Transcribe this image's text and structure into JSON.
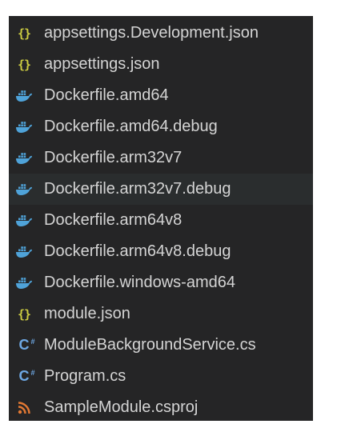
{
  "explorer": {
    "hovered_index": 5,
    "files": [
      {
        "label": "appsettings.Development.json",
        "icon": "json-icon"
      },
      {
        "label": "appsettings.json",
        "icon": "json-icon"
      },
      {
        "label": "Dockerfile.amd64",
        "icon": "docker-icon"
      },
      {
        "label": "Dockerfile.amd64.debug",
        "icon": "docker-icon"
      },
      {
        "label": "Dockerfile.arm32v7",
        "icon": "docker-icon"
      },
      {
        "label": "Dockerfile.arm32v7.debug",
        "icon": "docker-icon"
      },
      {
        "label": "Dockerfile.arm64v8",
        "icon": "docker-icon"
      },
      {
        "label": "Dockerfile.arm64v8.debug",
        "icon": "docker-icon"
      },
      {
        "label": "Dockerfile.windows-amd64",
        "icon": "docker-icon"
      },
      {
        "label": "module.json",
        "icon": "json-icon"
      },
      {
        "label": "ModuleBackgroundService.cs",
        "icon": "csharp-icon"
      },
      {
        "label": "Program.cs",
        "icon": "csharp-icon"
      },
      {
        "label": "SampleModule.csproj",
        "icon": "rss-icon"
      }
    ]
  },
  "colors": {
    "panel_bg": "#252526",
    "hover_bg": "#2a2d2e",
    "text": "#d4d4d4",
    "json_icon": "#cbcb41",
    "docker_icon": "#4fa3d9",
    "csharp_icon": "#6ea8e4",
    "rss_icon": "#e37933"
  }
}
